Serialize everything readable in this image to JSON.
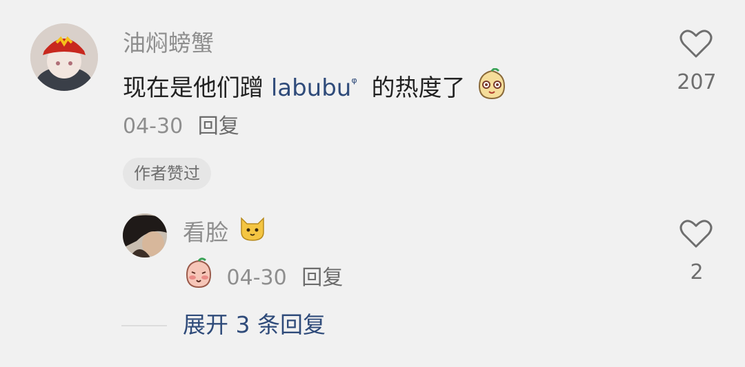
{
  "comment": {
    "username": "油焖螃蟹",
    "text_before": "现在是他们蹭 ",
    "link_text": "labubu",
    "search_mark": "ᵠ",
    "text_after": " 的热度了",
    "emoji": "peach-face-emoji",
    "date": "04-30",
    "reply_label": "回复",
    "author_liked_badge": "作者赞过",
    "like_count": "207"
  },
  "reply": {
    "username": "看脸",
    "username_emoji": "cat-face-emoji",
    "sticker": "peach-blush-sticker",
    "date": "04-30",
    "reply_label": "回复",
    "like_count": "2"
  },
  "expand": {
    "label": "展开 3 条回复"
  },
  "colors": {
    "background": "#f1f1f1",
    "link": "#2f4b7a",
    "muted": "#8e8e8e"
  }
}
